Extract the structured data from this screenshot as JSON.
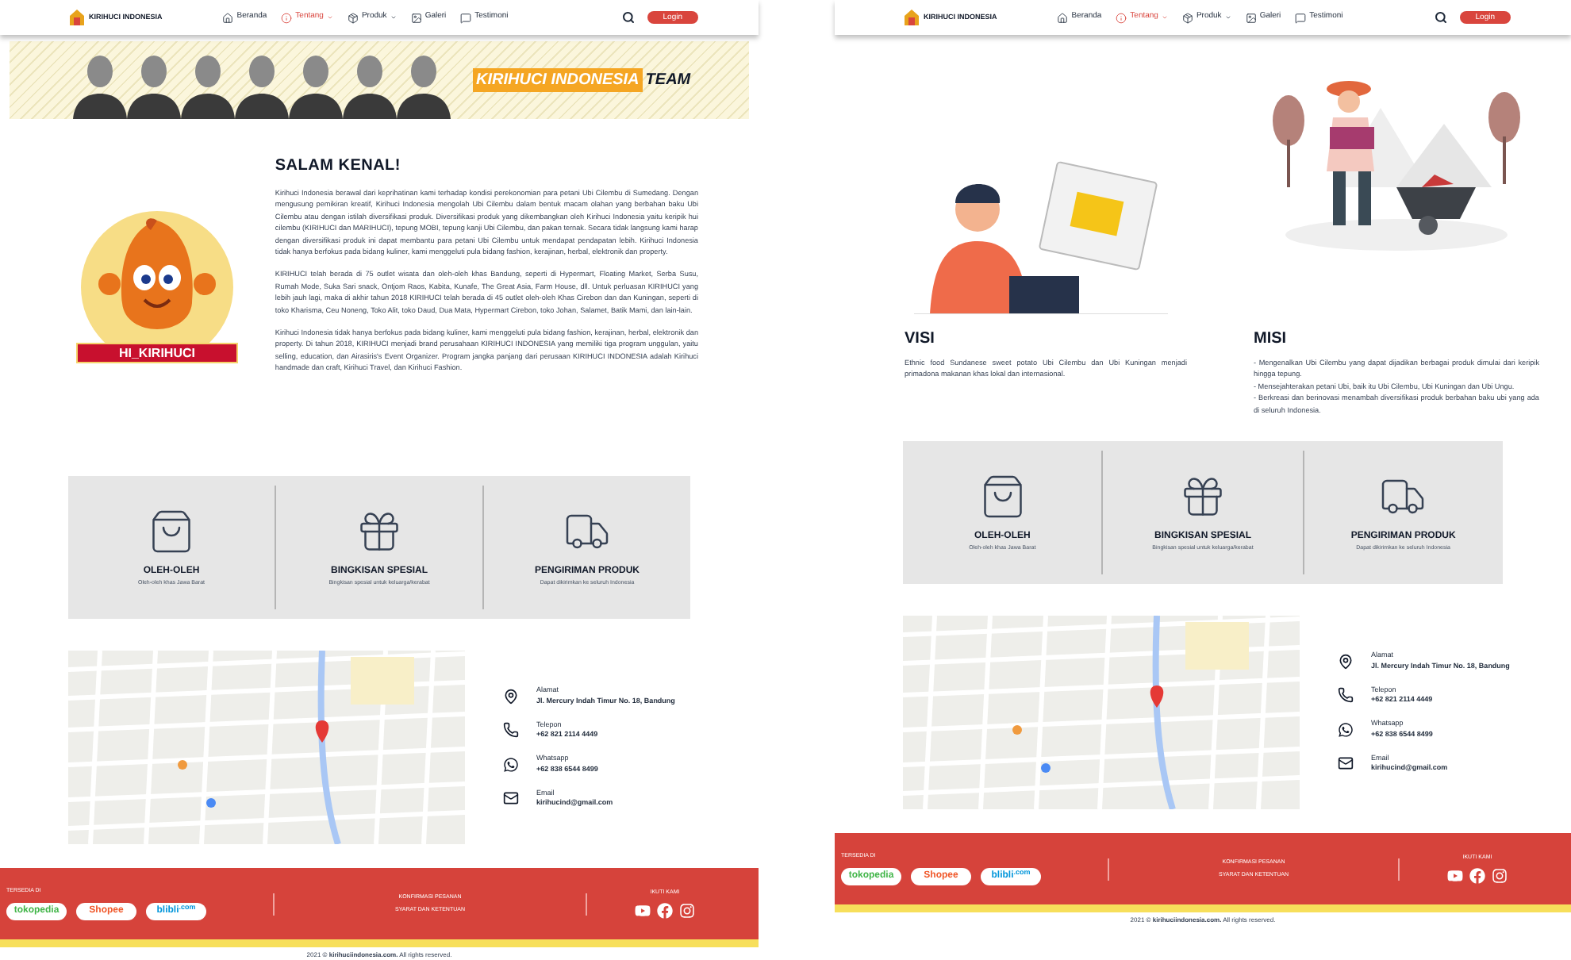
{
  "pages": [
    {
      "header": {
        "brand": "KIRIHUCI INDONESIA",
        "nav": [
          {
            "label": "Beranda",
            "kind": "home",
            "selected": false,
            "dropdown": false
          },
          {
            "label": "Tentang",
            "kind": "info",
            "selected": true,
            "dropdown": true
          },
          {
            "label": "Produk",
            "kind": "box",
            "selected": false,
            "dropdown": true
          },
          {
            "label": "Galeri",
            "kind": "image",
            "selected": false,
            "dropdown": false
          },
          {
            "label": "Testimoni",
            "kind": "chat",
            "selected": false,
            "dropdown": false
          }
        ],
        "login": "Login"
      },
      "banner": {
        "highlight": "KIRIHUCI INDONESIA",
        "suffix": "TEAM"
      },
      "content": {
        "kind": "about",
        "mascot_label": "HI_KIRIHUCI",
        "title": "SALAM KENAL!",
        "paragraphs": [
          "Kirihuci Indonesia berawal dari keprihatinan kami terhadap kondisi perekonomian para petani Ubi Cilembu di Sumedang. Dengan mengusung pemikiran kreatif, Kirihuci Indonesia mengolah Ubi Cilembu dalam bentuk macam olahan yang berbahan baku Ubi Cilembu atau dengan istilah diversifikasi produk. Diversifikasi produk yang dikembangkan oleh Kirihuci Indonesia yaitu keripik hui cilembu (KIRIHUCI dan MARIHUCI), tepung MOBI, tepung kanji Ubi Cilembu, dan pakan ternak. Secara tidak langsung kami harap dengan diversifikasi produk ini dapat membantu para petani Ubi Cilembu untuk mendapat pendapatan lebih. Kirihuci Indonesia tidak hanya berfokus pada bidang kuliner, kami menggeluti pula bidang fashion, kerajinan, herbal, elektronik dan property.",
          "KIRIHUCI telah berada di 75 outlet wisata dan oleh-oleh khas Bandung, seperti di Hypermart, Floating Market, Serba Susu, Rumah Mode, Suka Sari snack, Ontjom Raos, Kabita, Kunafe, The Great Asia, Farm House, dll. Untuk perluasan KIRIHUCI yang lebih jauh lagi, maka di akhir tahun 2018 KIRIHUCI telah berada di 45 outlet oleh-oleh Khas Cirebon dan dan Kuningan, seperti di toko Kharisma, Ceu Noneng, Toko Alit, toko Daud, Dua Mata, Hypermart Cirebon, toko Johan, Salamet, Batik Mami, dan lain-lain.",
          "Kirihuci Indonesia tidak hanya berfokus pada bidang kuliner, kami menggeluti pula bidang fashion, kerajinan, herbal, elektronik dan property. Di tahun 2018, KIRIHUCI menjadi brand perusahaan KIRIHUCI INDONESIA yang memiliki tiga program unggulan, yaitu selling, education, dan Airasiris's Event Organizer. Program jangka panjang dari perusaan KIRIHUCI INDONESIA adalah Kirihuci handmade dan craft, Kirihuci Travel, dan Kirihuci Fashion."
        ]
      },
      "features": [
        {
          "kind": "bag",
          "title": "OLEH-OLEH",
          "subtitle": "Oleh-oleh khas Jawa Barat"
        },
        {
          "kind": "gift",
          "title": "BINGKISAN SPESIAL",
          "subtitle": "Bingkisan spesial untuk keluarga/kerabat"
        },
        {
          "kind": "truck",
          "title": "PENGIRIMAN PRODUK",
          "subtitle": "Dapat dikirimkan ke seluruh Indonesia"
        }
      ],
      "contact": [
        {
          "kind": "address",
          "label": "Alamat",
          "value": "Jl. Mercury Indah Timur No. 18, Bandung"
        },
        {
          "kind": "phone",
          "label": "Telepon",
          "value": "+62 821 2114 4449"
        },
        {
          "kind": "whatsapp",
          "label": "Whatsapp",
          "value": "+62 838 6544 8499"
        },
        {
          "kind": "email",
          "label": "Email",
          "value": "kirihucind@gmail.com"
        }
      ],
      "footer": {
        "available": "TERSEDIA DI",
        "stores": [
          {
            "label": "tokopedia",
            "color": "#42b549"
          },
          {
            "label": "Shopee",
            "color": "#f0582a"
          },
          {
            "label": "blibli$^{.com}$",
            "color": "#0095da"
          }
        ],
        "links": [
          "KONFIRMASI PESANAN",
          "SYARAT DAN KETENTUAN"
        ],
        "follow": "IKUTI KAMI",
        "socials": [
          {
            "kind": "youtube"
          },
          {
            "kind": "facebook"
          },
          {
            "kind": "instagram"
          }
        ],
        "copyright": "2021 © **kirihuciindonesia.com.** All rights reserved."
      }
    },
    {
      "header": {
        "brand": "KIRIHUCI INDONESIA",
        "nav": [
          {
            "label": "Beranda",
            "kind": "home",
            "selected": false,
            "dropdown": false
          },
          {
            "label": "Tentang",
            "kind": "info",
            "selected": true,
            "dropdown": true
          },
          {
            "label": "Produk",
            "kind": "box",
            "selected": false,
            "dropdown": true
          },
          {
            "label": "Galeri",
            "kind": "image",
            "selected": false,
            "dropdown": false
          },
          {
            "label": "Testimoni",
            "kind": "chat",
            "selected": false,
            "dropdown": false
          }
        ],
        "login": "Login"
      },
      "content": {
        "kind": "vision",
        "vision_title": "VISI",
        "vision_text": "Ethnic food Sundanese sweet potato Ubi Cilembu dan Ubi Kuningan menjadi primadona makanan khas lokal dan internasional.",
        "mission_title": "MISI",
        "missions": [
          "- Mengenalkan Ubi Cilembu yang dapat dijadikan berbagai produk dimulai dari keripik hingga tepung.",
          "- Mensejahterakan petani Ubi, baik itu Ubi Cilembu, Ubi Kuningan dan Ubi Ungu.",
          "- Berkreasi dan berinovasi menambah diversifikasi produk berbahan baku ubi yang ada di seluruh Indonesia."
        ]
      },
      "features": [
        {
          "kind": "bag",
          "title": "OLEH-OLEH",
          "subtitle": "Oleh-oleh khas Jawa Barat"
        },
        {
          "kind": "gift",
          "title": "BINGKISAN SPESIAL",
          "subtitle": "Bingkisan spesial untuk keluarga/kerabat"
        },
        {
          "kind": "truck",
          "title": "PENGIRIMAN PRODUK",
          "subtitle": "Dapat dikirimkan ke seluruh Indonesia"
        }
      ],
      "contact": [
        {
          "kind": "address",
          "label": "Alamat",
          "value": "Jl. Mercury Indah Timur No. 18, Bandung"
        },
        {
          "kind": "phone",
          "label": "Telepon",
          "value": "+62 821 2114 4449"
        },
        {
          "kind": "whatsapp",
          "label": "Whatsapp",
          "value": "+62 838 6544 8499"
        },
        {
          "kind": "email",
          "label": "Email",
          "value": "kirihucind@gmail.com"
        }
      ],
      "footer": {
        "available": "TERSEDIA DI",
        "stores": [
          {
            "label": "tokopedia",
            "color": "#42b549"
          },
          {
            "label": "Shopee",
            "color": "#f0582a"
          },
          {
            "label": "blibli$^{.com}$",
            "color": "#0095da"
          }
        ],
        "links": [
          "KONFIRMASI PESANAN",
          "SYARAT DAN KETENTUAN"
        ],
        "follow": "IKUTI KAMI",
        "socials": [
          {
            "kind": "youtube"
          },
          {
            "kind": "facebook"
          },
          {
            "kind": "instagram"
          }
        ],
        "copyright": "2021 © **kirihuciindonesia.com.** All rights reserved."
      }
    }
  ]
}
